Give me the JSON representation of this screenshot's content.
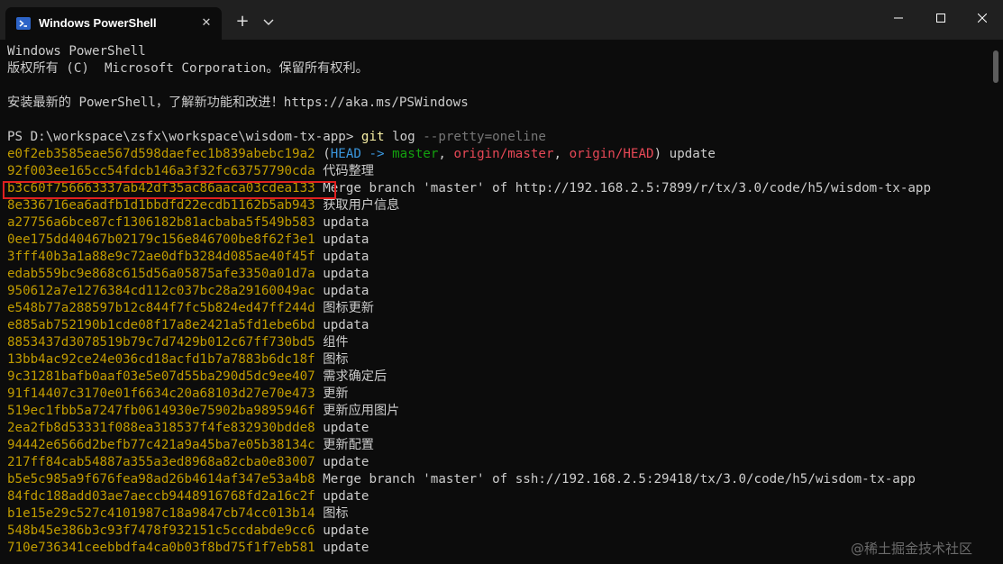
{
  "window": {
    "tab_title": "Windows PowerShell",
    "tab_close_glyph": "✕",
    "new_tab_glyph": "+",
    "icons": {
      "tab_icon": "powershell-icon",
      "tab_menu": "chevron-down-icon",
      "minimize": "minimize-icon",
      "maximize": "maximize-icon",
      "close": "close-icon"
    }
  },
  "terminal": {
    "banner": {
      "line1": "Windows PowerShell",
      "line2": "版权所有 (C)  Microsoft Corporation。保留所有权利。",
      "line3": "安装最新的 PowerShell，了解新功能和改进！https://aka.ms/PSWindows"
    },
    "prompt": {
      "path": "PS D:\\workspace\\zsfx\\workspace\\wisdom-tx-app> ",
      "command": "git",
      "subcommand": " log ",
      "option": "--pretty=oneline"
    },
    "first_commit": {
      "hash": "e0f2eb3585eae567d598daefec1b839abebc19a2",
      "open": " (",
      "head": "HEAD -> ",
      "master": "master",
      "sep1": ", ",
      "origin_master": "origin/master",
      "sep2": ", ",
      "origin_head": "origin/HEAD",
      "close": ")",
      "message": " update"
    },
    "commits": [
      {
        "hash": "92f003ee165cc54fdcb146a3f32fc63757790cda",
        "message": " 代码整理"
      },
      {
        "hash": "b3c60f756663337ab42df35ac86aaca03cdea133",
        "message": " Merge branch 'master' of http://192.168.2.5:7899/r/tx/3.0/code/h5/wisdom-tx-app"
      },
      {
        "hash": "8e336716ea6adfb1d1bbdfd22ecdb1162b5ab943",
        "message": " 获取用户信息"
      },
      {
        "hash": "a27756a6bce87cf1306182b81acbaba5f549b583",
        "message": " updata"
      },
      {
        "hash": "0ee175dd40467b02179c156e846700be8f62f3e1",
        "message": " updata"
      },
      {
        "hash": "3fff40b3a1a88e9c72ae0dfb3284d085ae40f45f",
        "message": " updata"
      },
      {
        "hash": "edab559bc9e868c615d56a05875afe3350a01d7a",
        "message": " updata"
      },
      {
        "hash": "950612a7e1276384cd112c037bc28a29160049ac",
        "message": " updata"
      },
      {
        "hash": "e548b77a288597b12c844f7fc5b824ed47ff244d",
        "message": " 图标更新"
      },
      {
        "hash": "e885ab752190b1cde08f17a8e2421a5fd1ebe6bd",
        "message": " updata"
      },
      {
        "hash": "8853437d3078519b79c7d7429b012c67ff730bd5",
        "message": " 组件"
      },
      {
        "hash": "13bb4ac92ce24e036cd18acfd1b7a7883b6dc18f",
        "message": " 图标"
      },
      {
        "hash": "9c31281bafb0aaf03e5e07d55ba290d5dc9ee407",
        "message": " 需求确定后"
      },
      {
        "hash": "91f14407c3170e01f6634c20a68103d27e70e473",
        "message": " 更新"
      },
      {
        "hash": "519ec1fbb5a7247fb0614930e75902ba9895946f",
        "message": " 更新应用图片"
      },
      {
        "hash": "2ea2fb8d53331f088ea318537f4fe832930bdde8",
        "message": " update"
      },
      {
        "hash": "94442e6566d2befb77c421a9a45ba7e05b38134c",
        "message": " 更新配置"
      },
      {
        "hash": "217ff84cab54887a355a3ed8968a82cba0e83007",
        "message": " update"
      },
      {
        "hash": "b5e5c985a9f676fea98ad26b4614af347e53a4b8",
        "message": " Merge branch 'master' of ssh://192.168.2.5:29418/tx/3.0/code/h5/wisdom-tx-app"
      },
      {
        "hash": "84fdc188add03ae7aeccb9448916768fd2a16c2f",
        "message": " update"
      },
      {
        "hash": "b1e15e29c527c4101987c18a9847cb74cc013b14",
        "message": " 图标"
      },
      {
        "hash": "548b45e386b3c93f7478f932151c5ccdabde9cc6",
        "message": " update"
      },
      {
        "hash": "710e736341ceebbdfa4ca0b03f8bd75f1f7eb581",
        "message": " update"
      }
    ],
    "highlighted_commit_index": 1
  },
  "watermark": "@稀土掘金技术社区",
  "colors": {
    "background": "#0c0c0c",
    "titlebar": "#202020",
    "hash": "#c19c00",
    "head": "#3a96dd",
    "branch": "#13a10e",
    "remote": "#e74856",
    "command": "#f9f1a5",
    "option": "#767676",
    "highlight_box": "#e02020"
  }
}
